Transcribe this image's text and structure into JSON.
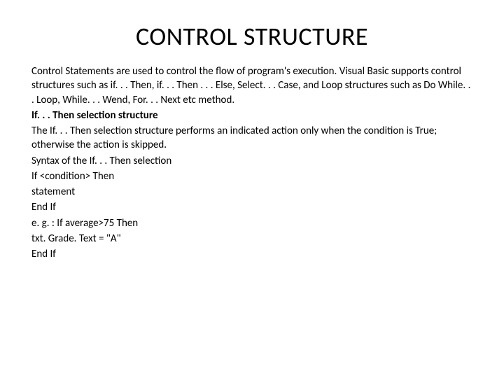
{
  "title": "CONTROL STRUCTURE",
  "p1": "Control Statements are used to control the flow of program's execution. Visual Basic supports control structures such as if. . . Then, if. . . Then . . . Else, Select. . . Case, and Loop structures such as Do While. . . Loop, While. . . Wend, For. . . Next etc method.",
  "p2": "If. . . Then selection structure",
  "p3": "The If. . . Then selection structure performs an indicated action only when the condition is True; otherwise the action is skipped.",
  "p4": "Syntax of the If. . . Then selection",
  "p5": "If <condition> Then",
  "p6": "statement",
  "p7": "End If",
  "p8": "e. g. : If average>75 Then",
  "p9": "txt. Grade. Text = \"A\"",
  "p10": "End If"
}
